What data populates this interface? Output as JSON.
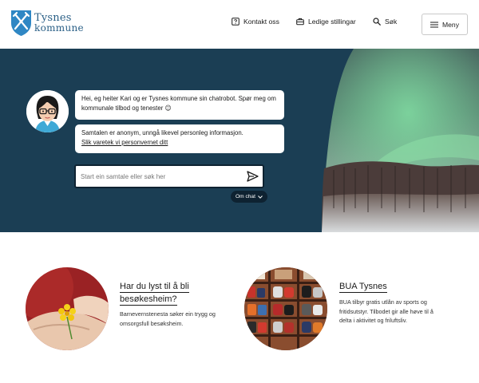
{
  "header": {
    "logo_line1": "Tysnes",
    "logo_line2": "kommune",
    "nav": [
      {
        "label": "Kontakt oss",
        "icon": "question-icon"
      },
      {
        "label": "Ledige stillingar",
        "icon": "briefcase-icon"
      },
      {
        "label": "Søk",
        "icon": "search-icon"
      }
    ],
    "menu_label": "Meny"
  },
  "hero": {
    "bubble1": "Hei, eg heiter Kari og er Tysnes kommune sin chatrobot. Spør meg om kommunale tilbod og tenester 😊",
    "bubble2_text": "Samtalen er anonym, unngå likevel personleg informasjon.",
    "bubble2_link": "Slik varetek vi personvernet ditt",
    "input_placeholder": "Start ein samtale eller søk her",
    "om_chat_label": "Om chat"
  },
  "cards": [
    {
      "title_line1": "Har du lyst til å bli",
      "title_line2": "besøkesheim?",
      "description": "Barnevernstenesta søker ein trygg og omsorgsfull besøksheim."
    },
    {
      "title_line1": "BUA Tysnes",
      "description": "BUA tilbyr gratis utlån av sports og fritidsutstyr. Tilbodet gir alle høve til å delta i aktivitet og friluftsliv."
    }
  ],
  "colors": {
    "hero_bg": "#1b3e54",
    "brand_blue": "#2a5f86",
    "dark": "#0e2231"
  }
}
